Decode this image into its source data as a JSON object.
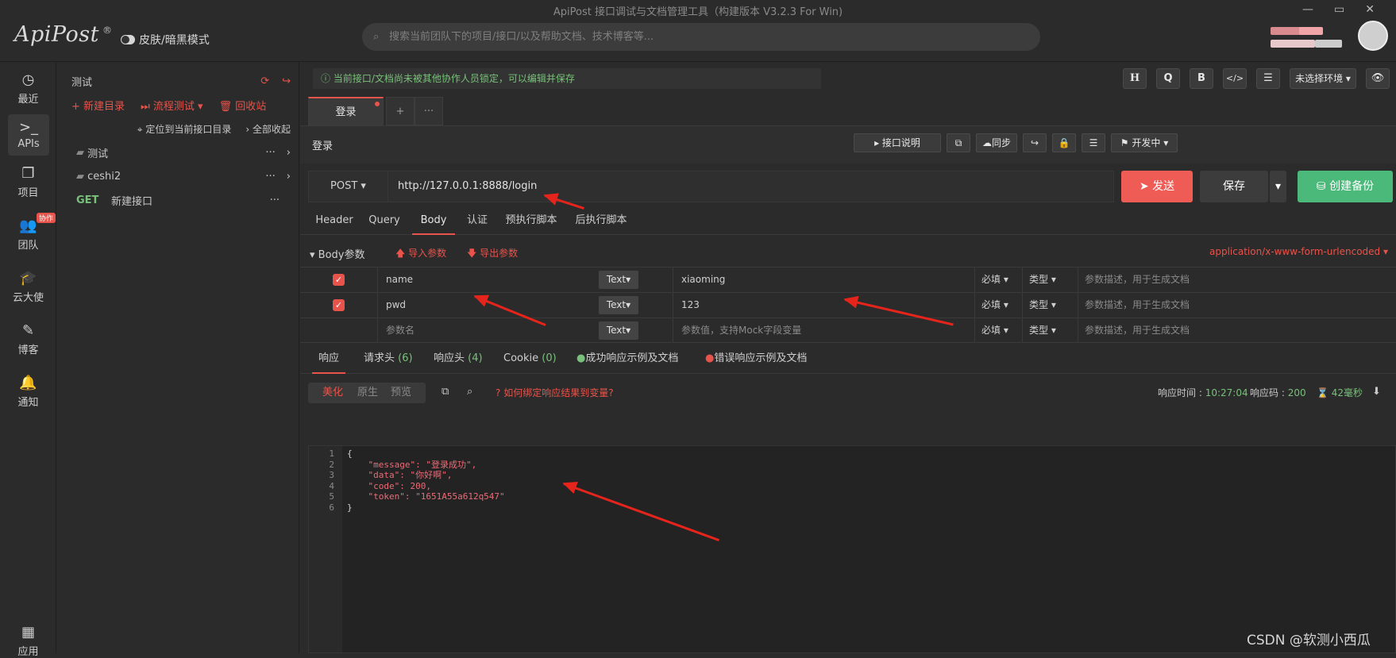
{
  "window": {
    "title": "ApiPost 接口调试与文档管理工具（构建版本 V3.2.3 For Win)"
  },
  "header": {
    "logo": "ApiPost",
    "logo_mark": "®",
    "skin_toggle": "皮肤/暗黑模式",
    "search_placeholder": "搜索当前团队下的项目/接口/以及帮助文档、技术博客等..."
  },
  "leftnav": [
    {
      "label": "最近",
      "icon": "clock-icon"
    },
    {
      "label": "APIs",
      "icon": "terminal-icon"
    },
    {
      "label": "项目",
      "icon": "projects-icon"
    },
    {
      "label": "团队",
      "icon": "team-icon",
      "badge": "协作"
    },
    {
      "label": "云大使",
      "icon": "graduation-cap-icon"
    },
    {
      "label": "博客",
      "icon": "edit-icon"
    },
    {
      "label": "通知",
      "icon": "bell-icon"
    },
    {
      "label": "应用",
      "icon": "grid-icon"
    }
  ],
  "tree": {
    "project": "测试",
    "new_dir": "新建目录",
    "flow_test": "流程测试",
    "recycle": "回收站",
    "locate": "定位到当前接口目录",
    "collapse": "全部收起",
    "items": [
      {
        "type": "folder",
        "label": "测试"
      },
      {
        "type": "folder",
        "label": "ceshi2"
      },
      {
        "type": "api",
        "method": "GET",
        "label": "新建接口"
      }
    ]
  },
  "main": {
    "lock_notice": "当前接口/文档尚未被其他协作人员锁定，可以编辑并保存",
    "toolbar": {
      "h": "H",
      "q": "Q",
      "b": "B",
      "code": "</>",
      "env": "未选择环境"
    },
    "tabs": [
      {
        "label": "登录"
      }
    ],
    "request_name": "登录",
    "req_actions": {
      "doc": "接口说明",
      "sync": "同步",
      "status": "开发中"
    },
    "method": "POST",
    "url": "http://127.0.0.1:8888/login",
    "send": "发送",
    "save": "保存",
    "backup": "创建备份",
    "req_tabs": [
      "Header",
      "Query",
      "Body",
      "认证",
      "预执行脚本",
      "后执行脚本"
    ],
    "body_label": "Body参数",
    "import_params": "导入参数",
    "export_params": "导出参数",
    "content_type": "application/x-www-form-urlencoded",
    "params": [
      {
        "key": "name",
        "type": "Text",
        "value": "xiaoming",
        "required": "必填",
        "kind": "类型",
        "desc_placeholder": "参数描述，用于生成文档"
      },
      {
        "key": "pwd",
        "type": "Text",
        "value": "123",
        "required": "必填",
        "kind": "类型",
        "desc_placeholder": "参数描述，用于生成文档"
      },
      {
        "key_placeholder": "参数名",
        "type": "Text",
        "value_placeholder": "参数值，支持Mock字段变量",
        "required": "必填",
        "kind": "类型",
        "desc_placeholder": "参数描述，用于生成文档"
      }
    ],
    "resp_tabs": {
      "response": "响应",
      "req_headers": "请求头",
      "req_headers_count": "(6)",
      "resp_headers": "响应头",
      "resp_headers_count": "(4)",
      "cookie": "Cookie",
      "cookie_count": "(0)",
      "success_example": "成功响应示例及文档",
      "error_example": "错误响应示例及文档"
    },
    "view_modes": [
      "美化",
      "原生",
      "预览"
    ],
    "bind_help": "如何绑定响应结果到变量?",
    "resp_time_label": "响应时间 :",
    "resp_time": "10:27:04",
    "resp_code_label": "响应码 :",
    "resp_code": "200",
    "resp_ms": "42毫秒",
    "code_lines": [
      "{",
      "    \"message\": \"登录成功\",",
      "    \"data\": \"你好啊\",",
      "    \"code\": 200,",
      "    \"token\": \"1651A55a612q547\"",
      "}"
    ]
  },
  "watermark": "CSDN @软测小西瓜",
  "colors": {
    "accent": "#e8534b",
    "send": "#ef5b55",
    "backup": "#4ab97a",
    "success": "#78c17a"
  }
}
